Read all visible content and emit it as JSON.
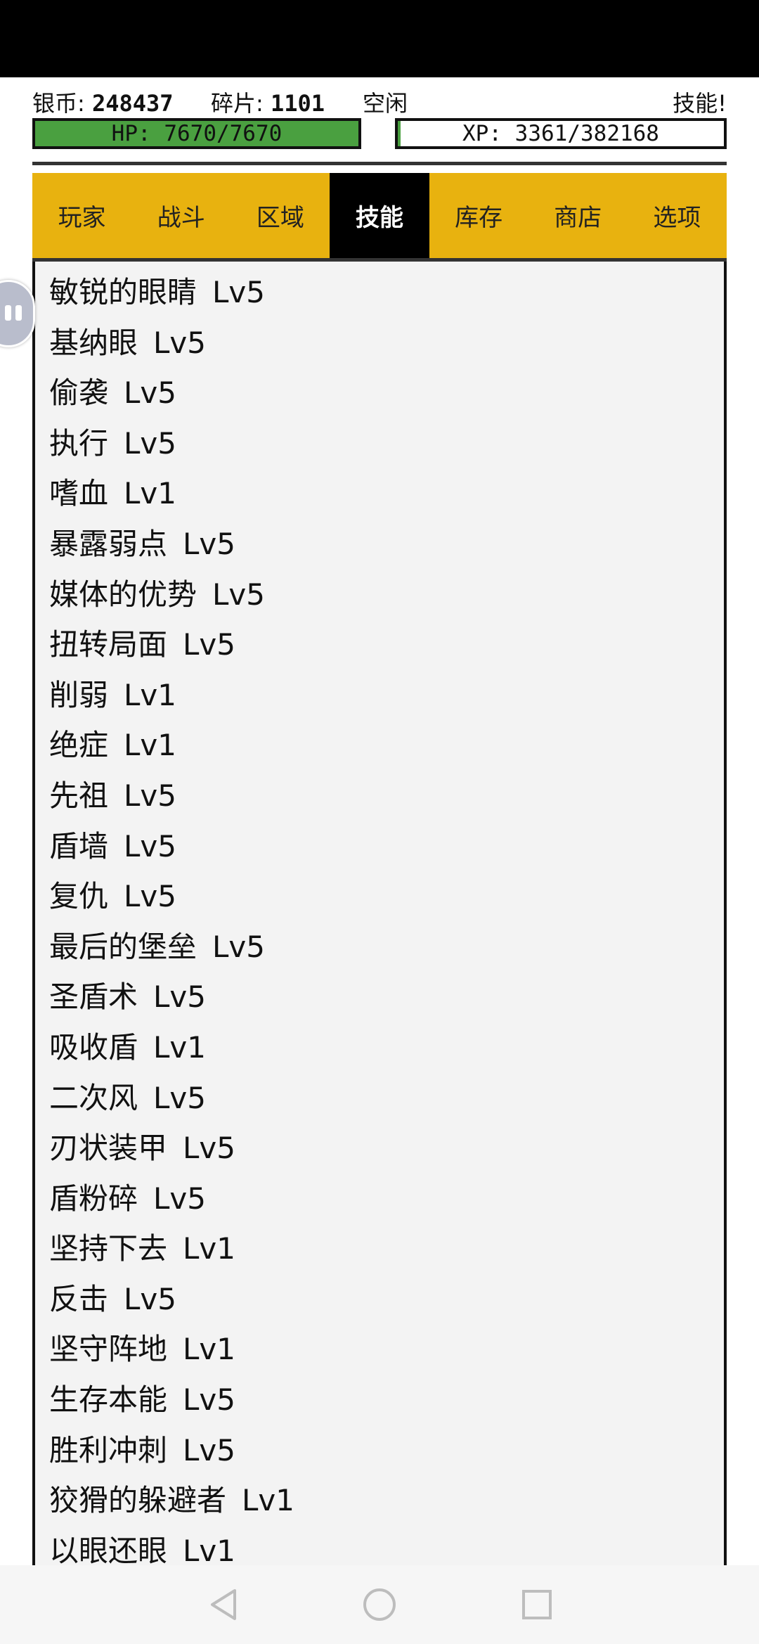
{
  "header": {
    "silver_label": "银币:",
    "silver_value": "248437",
    "shards_label": "碎片:",
    "shards_value": "1101",
    "status": "空闲",
    "skill_alert": "技能!"
  },
  "hp": {
    "text": "HP: 7670/7670",
    "fill": 1.0,
    "color": "#4aa040"
  },
  "xp": {
    "text": "XP: 3361/382168",
    "fill": 0.0088
  },
  "tabs": [
    {
      "label": "玩家"
    },
    {
      "label": "战斗"
    },
    {
      "label": "区域"
    },
    {
      "label": "技能",
      "active": true
    },
    {
      "label": "库存"
    },
    {
      "label": "商店"
    },
    {
      "label": "选项"
    }
  ],
  "skills": [
    {
      "name": "敏锐的眼睛",
      "level": "Lv5"
    },
    {
      "name": "基纳眼",
      "level": "Lv5"
    },
    {
      "name": "偷袭",
      "level": "Lv5"
    },
    {
      "name": "执行",
      "level": "Lv5"
    },
    {
      "name": "嗜血",
      "level": "Lv1"
    },
    {
      "name": "暴露弱点",
      "level": "Lv5"
    },
    {
      "name": "媒体的优势",
      "level": "Lv5"
    },
    {
      "name": "扭转局面",
      "level": "Lv5"
    },
    {
      "name": "削弱",
      "level": "Lv1"
    },
    {
      "name": "绝症",
      "level": "Lv1"
    },
    {
      "name": "先祖",
      "level": "Lv5"
    },
    {
      "name": "盾墙",
      "level": "Lv5"
    },
    {
      "name": "复仇",
      "level": "Lv5"
    },
    {
      "name": "最后的堡垒",
      "level": "Lv5"
    },
    {
      "name": "圣盾术",
      "level": "Lv5"
    },
    {
      "name": "吸收盾",
      "level": "Lv1"
    },
    {
      "name": "二次风",
      "level": "Lv5"
    },
    {
      "name": "刃状装甲",
      "level": "Lv5"
    },
    {
      "name": "盾粉碎",
      "level": "Lv5"
    },
    {
      "name": "坚持下去",
      "level": "Lv1"
    },
    {
      "name": "反击",
      "level": "Lv5"
    },
    {
      "name": "坚守阵地",
      "level": "Lv1"
    },
    {
      "name": "生存本能",
      "level": "Lv5"
    },
    {
      "name": "胜利冲刺",
      "level": "Lv5"
    },
    {
      "name": "狡猾的躲避者",
      "level": "Lv1"
    },
    {
      "name": "以眼还眼",
      "level": "Lv1"
    }
  ],
  "icons": {
    "floating": "pause-bubble-icon",
    "nav_back": "back-triangle-icon",
    "nav_home": "home-circle-icon",
    "nav_recent": "recent-square-icon"
  }
}
